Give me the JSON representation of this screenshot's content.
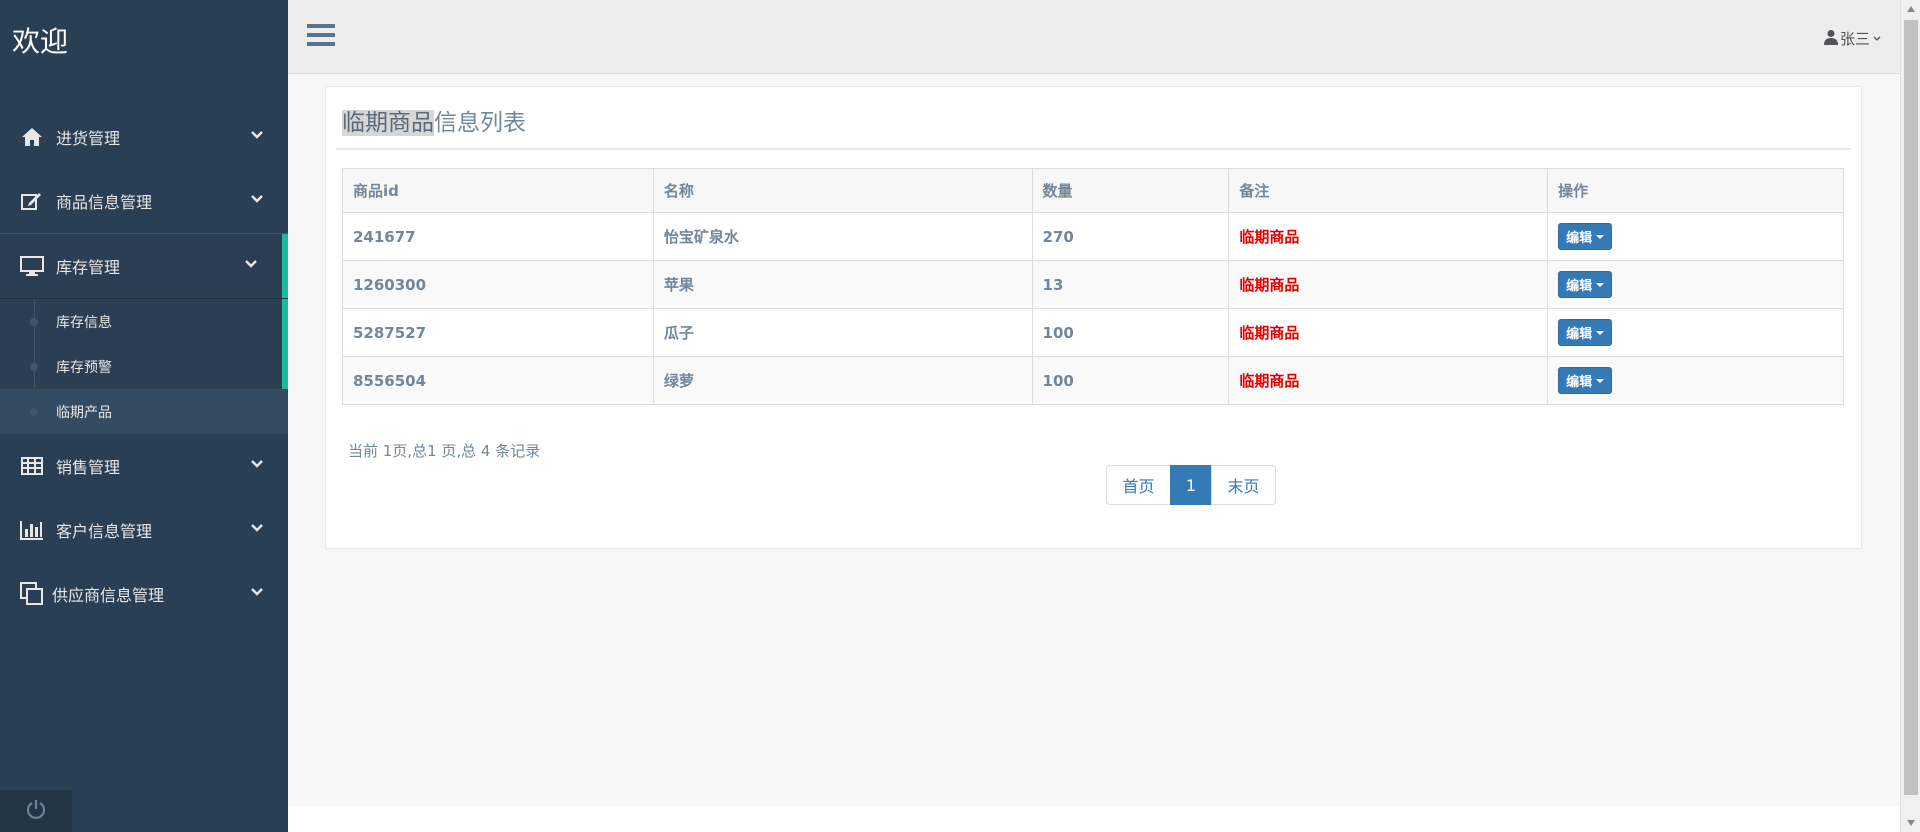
{
  "sidebar": {
    "brand": "欢迎",
    "menu": [
      {
        "label": "进货管理",
        "icon": "home-icon"
      },
      {
        "label": "商品信息管理",
        "icon": "edit-icon"
      },
      {
        "label": "库存管理",
        "icon": "desktop-icon"
      },
      {
        "label": "销售管理",
        "icon": "table-icon"
      },
      {
        "label": "客户信息管理",
        "icon": "bar-chart-icon"
      },
      {
        "label": "供应商信息管理",
        "icon": "clone-icon"
      }
    ],
    "submenu": [
      {
        "label": "库存信息"
      },
      {
        "label": "库存预警"
      },
      {
        "label": "临期产品"
      }
    ],
    "footer_icon": "power-icon"
  },
  "topnav": {
    "user_name": "张三"
  },
  "panel": {
    "title_highlight": "临期商品",
    "title_rest": "信息列表",
    "columns": [
      "商品id",
      "名称",
      "数量",
      "备注",
      "操作"
    ],
    "rows": [
      {
        "id": "241677",
        "name": "怡宝矿泉水",
        "qty": "270",
        "remark": "临期商品",
        "action": "编辑"
      },
      {
        "id": "1260300",
        "name": "苹果",
        "qty": "13",
        "remark": "临期商品",
        "action": "编辑"
      },
      {
        "id": "5287527",
        "name": "瓜子",
        "qty": "100",
        "remark": "临期商品",
        "action": "编辑"
      },
      {
        "id": "8556504",
        "name": "绿萝",
        "qty": "100",
        "remark": "临期商品",
        "action": "编辑"
      }
    ],
    "summary": "当前 1页,总1 页,总 4 条记录",
    "pager": {
      "first": "首页",
      "current": "1",
      "last": "末页"
    }
  },
  "colors": {
    "sidebar_bg": "#2a3f54",
    "accent": "#1abb9c",
    "primary": "#337ab7",
    "remark": "#e60000"
  }
}
